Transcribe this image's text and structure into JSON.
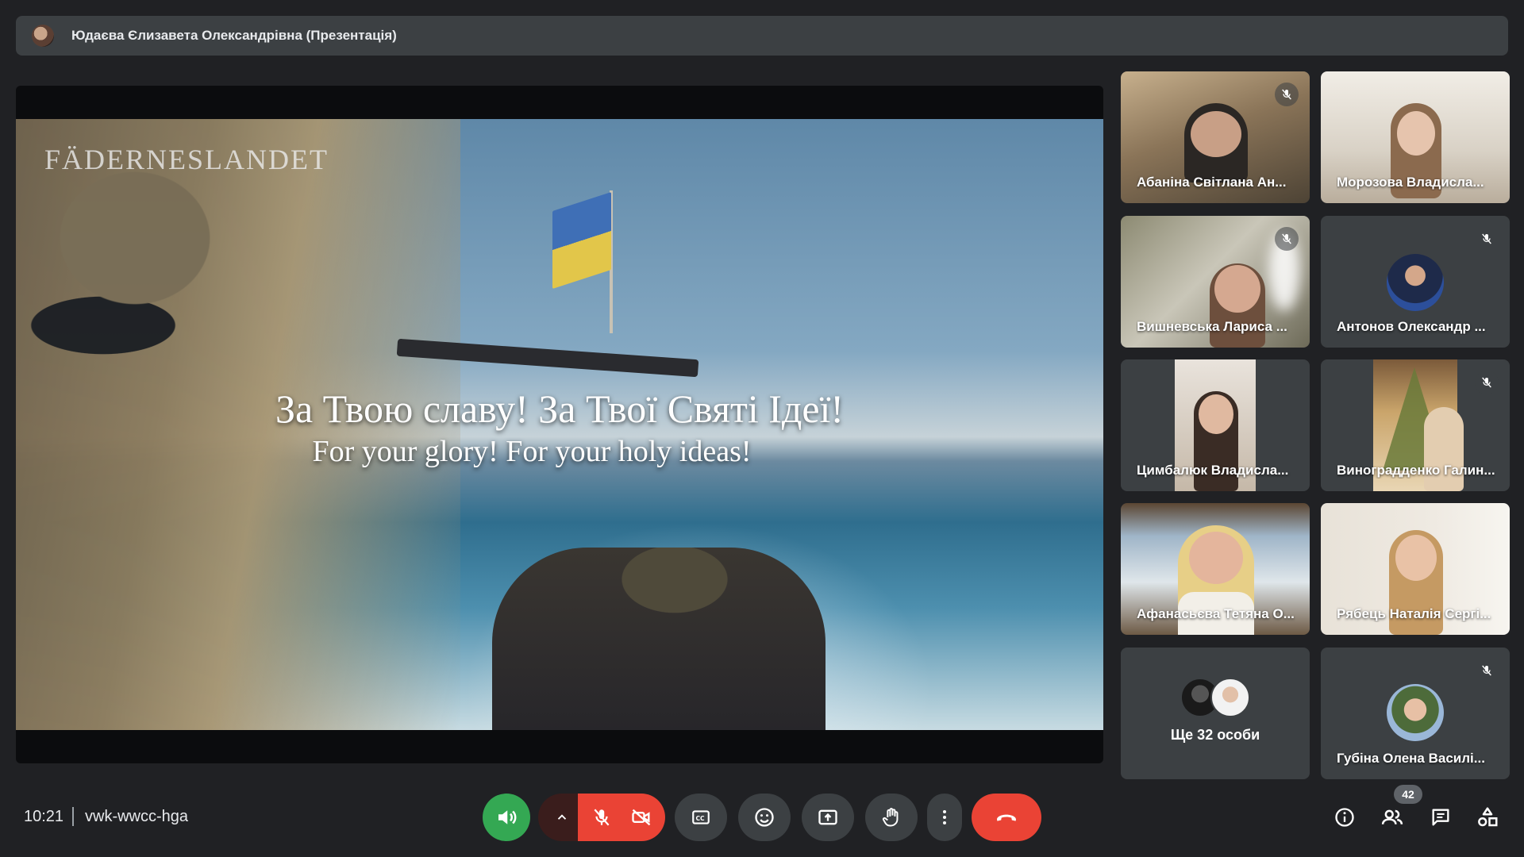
{
  "header": {
    "title": "Юдаєва Єлизавета Олександрівна (Презентація)"
  },
  "presentation": {
    "watermark": "FÄDERNESLANDET",
    "line_ua": "За Твою славу! За Твої Святі Ідеї!",
    "line_en": "For your glory! For your holy ideas!"
  },
  "participants": [
    {
      "name": "Абаніна Світлана Ан...",
      "muted": true
    },
    {
      "name": "Морозова Владисла...",
      "muted": false
    },
    {
      "name": "Вишневська Лариса ...",
      "muted": true
    },
    {
      "name": "Антонов Олександр ...",
      "muted": true
    },
    {
      "name": "Цимбалюк Владисла...",
      "muted": false
    },
    {
      "name": "Виноградденко Галин...",
      "muted": true
    },
    {
      "name": "Афанасьєва Тетяна О...",
      "muted": false
    },
    {
      "name": "Рябець Наталія Сергі...",
      "muted": false
    },
    {
      "name": "Губіна Олена Василі...",
      "muted": true
    }
  ],
  "more_participants": {
    "label": "Ще 32 особи"
  },
  "footer": {
    "time": "10:21",
    "meeting_code": "vwk-wwcc-hga",
    "participants_count": "42"
  },
  "icons": {
    "volume": "volume-icon",
    "chevron": "chevron-up-icon",
    "mic": "mic-off-icon",
    "camera": "camera-off-icon",
    "captions": "captions-icon",
    "emoji": "emoji-icon",
    "present": "present-icon",
    "hand": "raise-hand-icon",
    "more": "more-vert-icon",
    "hangup": "hangup-icon",
    "info": "info-icon",
    "people": "people-icon",
    "chat": "chat-icon",
    "activities": "activities-icon"
  },
  "colors": {
    "accent_green": "#34a853",
    "danger_red": "#ea4335",
    "panel": "#3c4043",
    "background": "#202124"
  }
}
